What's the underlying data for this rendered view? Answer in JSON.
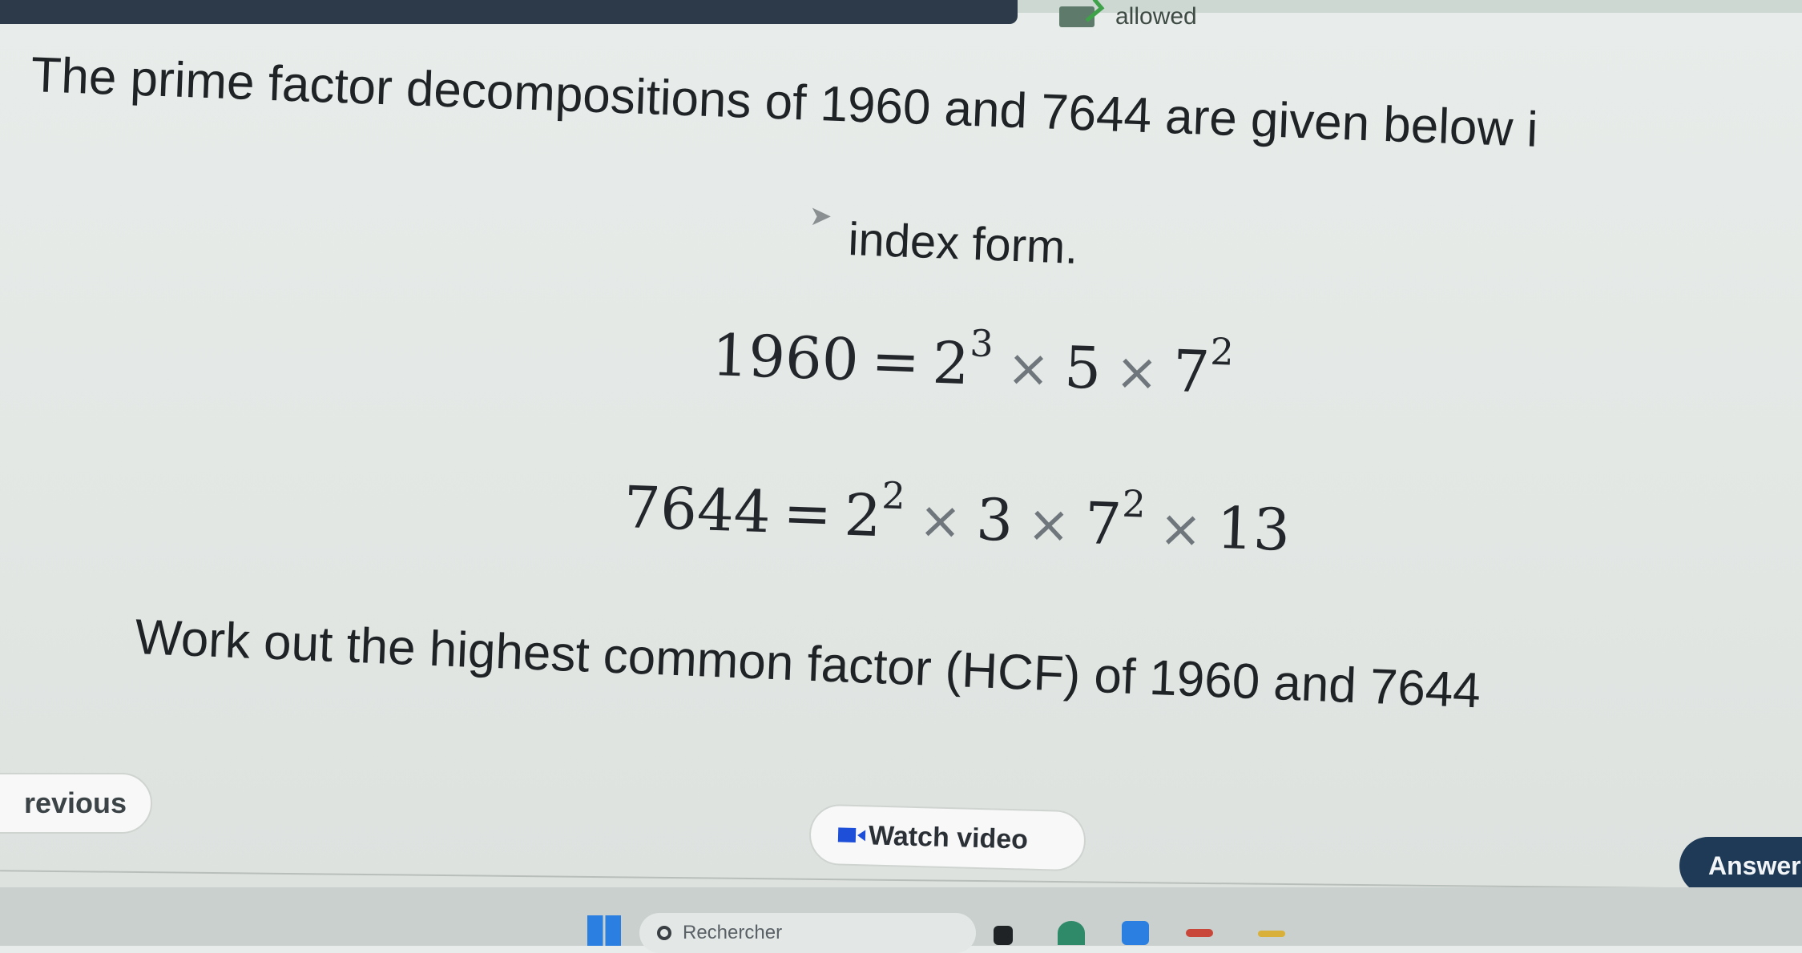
{
  "header": {
    "calculator_status": "allowed"
  },
  "question": {
    "intro_line1": "The prime factor decompositions of 1960 and 7644 are given below i",
    "intro_line2": "index form.",
    "equation1": {
      "lhs": "1960",
      "base1": "2",
      "exp1": "3",
      "factor2": "5",
      "base3": "7",
      "exp3": "2"
    },
    "equation2": {
      "lhs": "7644",
      "base1": "2",
      "exp1": "2",
      "factor2": "3",
      "base3": "7",
      "exp3": "2",
      "factor4": "13"
    },
    "task": "Work out the highest common factor (HCF) of 1960 and 7644"
  },
  "nav": {
    "previous_label": "revious",
    "watch_video_label": "Watch video",
    "answer_label": "Answer"
  },
  "taskbar": {
    "search_placeholder": "Rechercher"
  },
  "colors": {
    "answer_button": "#1f3a56",
    "video_icon": "#1e4fd9",
    "calculator_check": "#3fa24a"
  }
}
